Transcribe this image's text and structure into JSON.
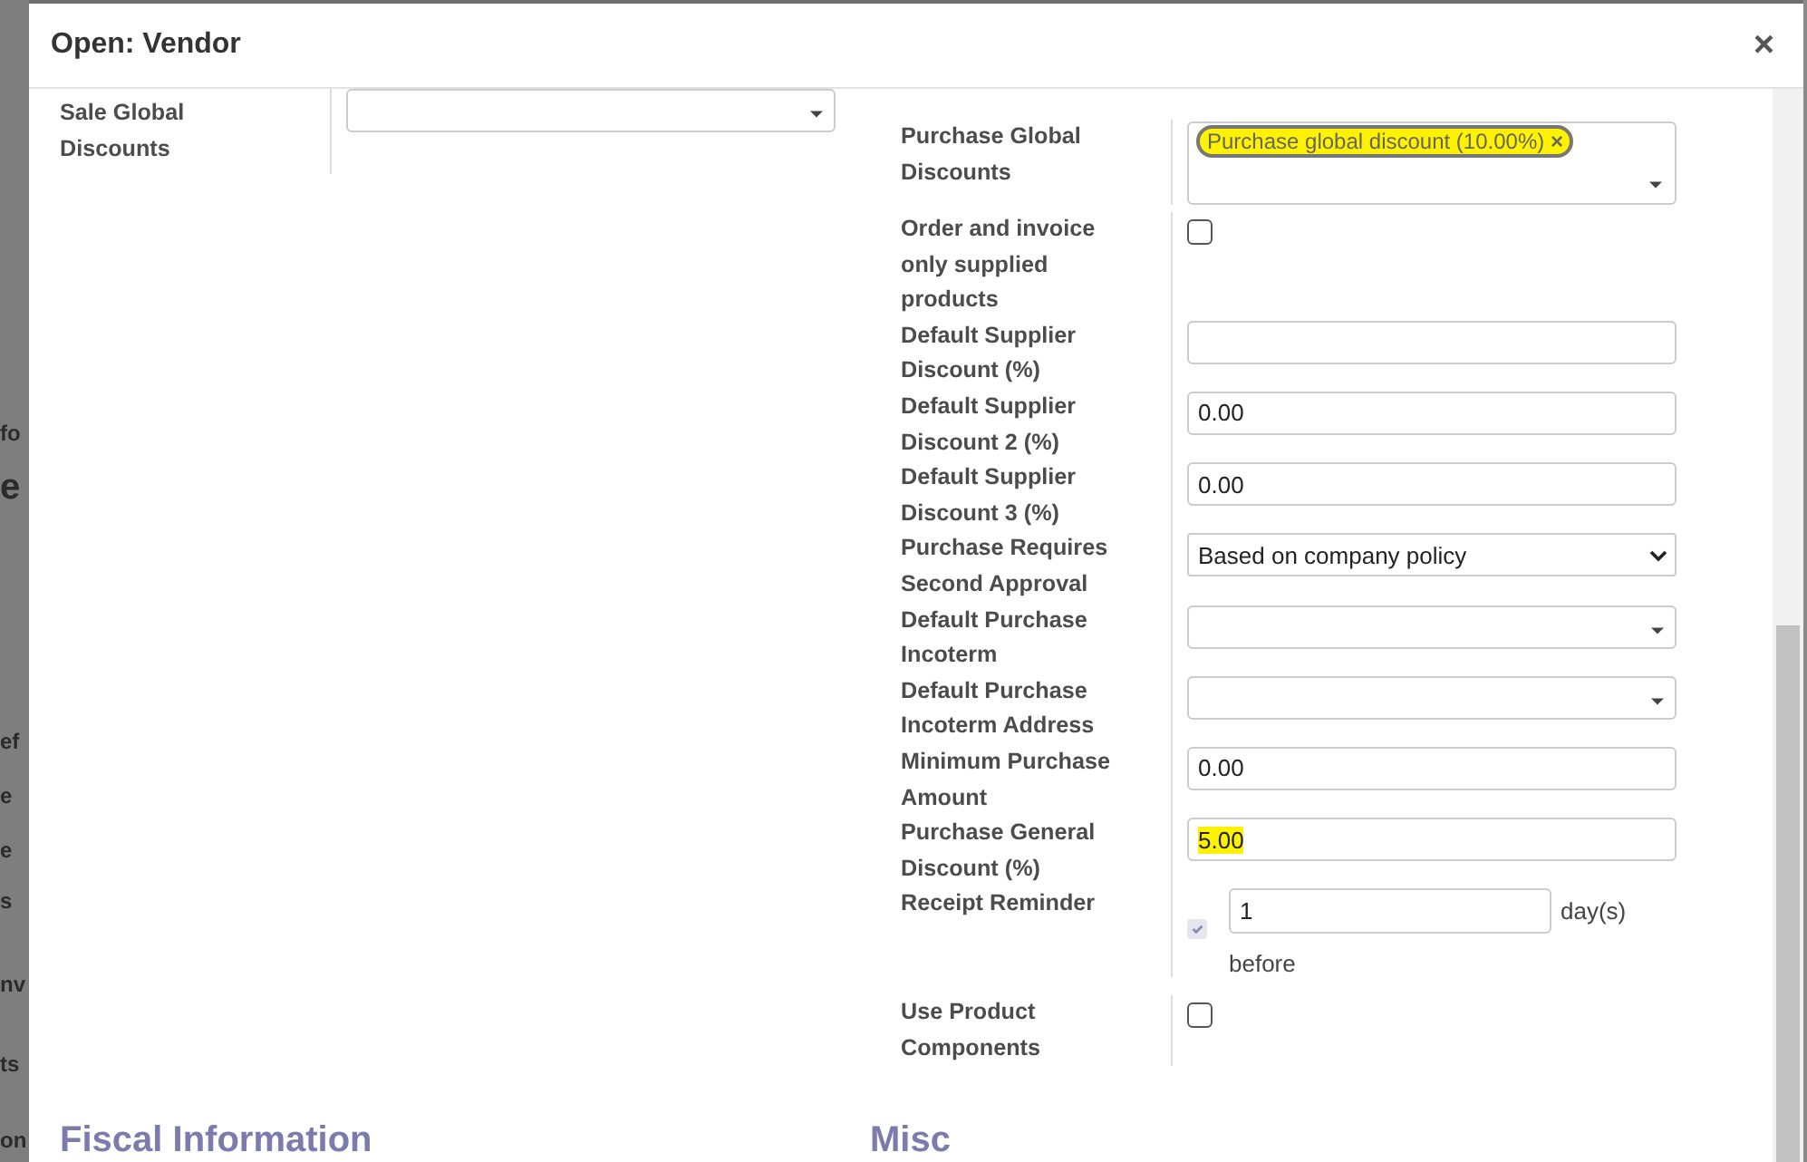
{
  "backdrop": {
    "fragments": [
      "fo",
      "e",
      "ef",
      "e",
      "e",
      "s",
      "nv",
      "ts",
      "on"
    ]
  },
  "dialog": {
    "title": "Open: Vendor",
    "close": "×"
  },
  "left_fields": [
    {
      "label": "Sale Global Discounts",
      "kind": "dropdown"
    }
  ],
  "right_fields": [
    {
      "label": "Purchase Global Discounts",
      "kind": "tags",
      "tags": [
        {
          "text": "Purchase global discount (10.00%)",
          "remove": "×",
          "highlighted": true
        }
      ]
    },
    {
      "label": "Order and invoice only supplied products",
      "kind": "checkbox",
      "checked": false
    },
    {
      "label": "Default Supplier Discount (%)",
      "kind": "input"
    },
    {
      "label": "Default Supplier Discount 2 (%)",
      "kind": "input",
      "value": "0.00"
    },
    {
      "label": "Default Supplier Discount 3 (%)",
      "kind": "input",
      "value": "0.00"
    },
    {
      "label": "Purchase Requires Second Approval",
      "kind": "select",
      "value": "Based on company policy"
    },
    {
      "label": "Default Purchase Incoterm",
      "kind": "dropdown"
    },
    {
      "label": "Default Purchase Incoterm Address",
      "kind": "dropdown"
    },
    {
      "label": "Minimum Purchase Amount",
      "kind": "input",
      "value": "0.00"
    },
    {
      "label": "Purchase General Discount (%)",
      "kind": "input",
      "value": "5.00",
      "highlighted": true
    },
    {
      "label": "Receipt Reminder",
      "kind": "reminder",
      "checked": true,
      "value": "1",
      "unit": "day(s)",
      "suffix": "before"
    },
    {
      "label": "Use Product Components",
      "kind": "checkbox",
      "checked": false
    }
  ],
  "sections": [
    "Fiscal Information",
    "Misc"
  ]
}
